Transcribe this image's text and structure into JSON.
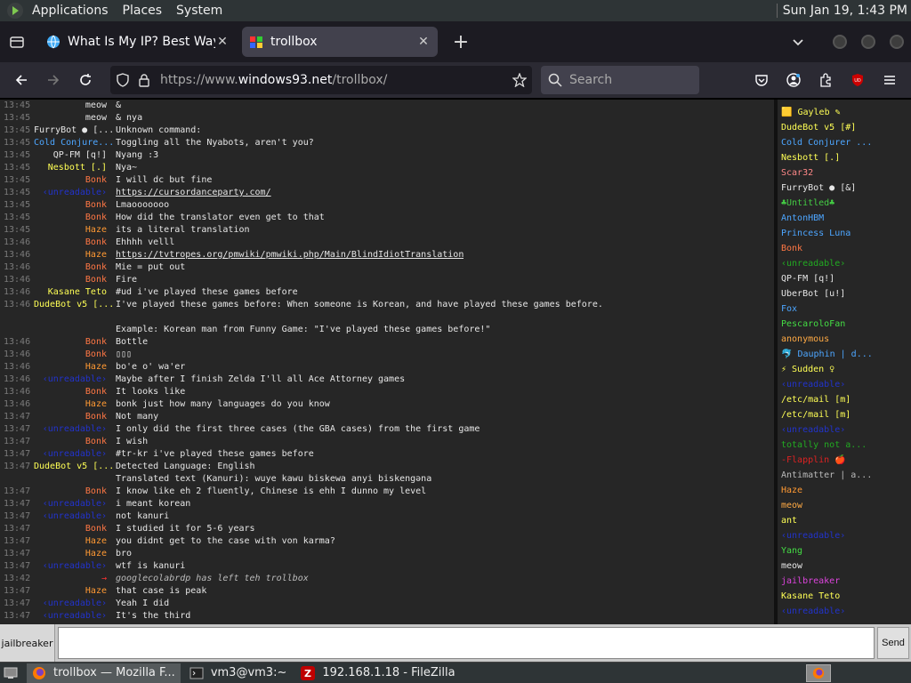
{
  "panel": {
    "menus": [
      "Applications",
      "Places",
      "System"
    ],
    "clock": "Sun Jan 19,  1:43 PM"
  },
  "tabs": [
    {
      "title": "What Is My IP? Best Way To",
      "active": false,
      "icon": "globe-icon"
    },
    {
      "title": "trollbox",
      "active": true,
      "icon": "windows93-icon"
    }
  ],
  "urlbar": {
    "prefix": "https://www.",
    "domain": "windows93.net",
    "path": "/trollbox/"
  },
  "search": {
    "placeholder": "Search"
  },
  "chat": [
    {
      "time": "13:45",
      "nick": "meow",
      "color": "#e6e6e6",
      "text": "&"
    },
    {
      "time": "13:45",
      "nick": "meow",
      "color": "#e6e6e6",
      "text": "& nya"
    },
    {
      "time": "13:45",
      "nick": "FurryBot ● [...",
      "color": "#e6e6e6",
      "text": "Unknown command:"
    },
    {
      "time": "13:45",
      "nick": "Cold Conjure...",
      "color": "#4da6ff",
      "text": "Toggling all the Nyabots, aren't you?"
    },
    {
      "time": "13:45",
      "nick": "QP-FM [q!]",
      "color": "#e6e6e6",
      "text": "Nyang :3"
    },
    {
      "time": "13:45",
      "nick": "Nesbott [.]",
      "color": "#ffff55",
      "text": "Nya~"
    },
    {
      "time": "13:45",
      "nick": "Bonk",
      "color": "#ff7744",
      "text": "I will dc but fine"
    },
    {
      "time": "13:45",
      "nick": "‹unreadable›",
      "color": "#2233cc",
      "text": "https://cursordanceparty.com/",
      "link": true
    },
    {
      "time": "13:45",
      "nick": "Bonk",
      "color": "#ff7744",
      "text": "Lmaooooooo"
    },
    {
      "time": "13:45",
      "nick": "Bonk",
      "color": "#ff7744",
      "text": "How did the translator even get to that"
    },
    {
      "time": "13:45",
      "nick": "Haze",
      "color": "#ff9933",
      "text": "its a literal translation"
    },
    {
      "time": "13:46",
      "nick": "Bonk",
      "color": "#ff7744",
      "text": "Ehhhh velll"
    },
    {
      "time": "13:46",
      "nick": "Haze",
      "color": "#ff9933",
      "text": "https://tvtropes.org/pmwiki/pmwiki.php/Main/BlindIdiotTranslation",
      "link": true
    },
    {
      "time": "13:46",
      "nick": "Bonk",
      "color": "#ff7744",
      "text": "Mie = put out"
    },
    {
      "time": "13:46",
      "nick": "Bonk",
      "color": "#ff7744",
      "text": "Fire"
    },
    {
      "time": "13:46",
      "nick": "Kasane Teto",
      "color": "#ffff55",
      "text": "#ud i've played these games before"
    },
    {
      "time": "13:46",
      "nick": "DudeBot v5 [...",
      "color": "#ffff55",
      "text": "I've played these games before: When someone is Korean, and have played these games before."
    },
    {
      "time": "",
      "nick": "",
      "color": "#e6e6e6",
      "text": ""
    },
    {
      "time": "",
      "nick": "",
      "color": "#e6e6e6",
      "text": "Example: Korean man from Funny Game: \"I've played these games before!\""
    },
    {
      "time": "13:46",
      "nick": "Bonk",
      "color": "#ff7744",
      "text": "Bottle"
    },
    {
      "time": "13:46",
      "nick": "Bonk",
      "color": "#ff7744",
      "text": "▯▯▯"
    },
    {
      "time": "13:46",
      "nick": "Haze",
      "color": "#ff9933",
      "text": "bo'e o' wa'er"
    },
    {
      "time": "13:46",
      "nick": "‹unreadable›",
      "color": "#2233cc",
      "text": "Maybe after I finish Zelda I'll all Ace Attorney games"
    },
    {
      "time": "13:46",
      "nick": "Bonk",
      "color": "#ff7744",
      "text": "It looks like"
    },
    {
      "time": "13:46",
      "nick": "Haze",
      "color": "#ff9933",
      "text": "bonk just how many languages do you know"
    },
    {
      "time": "13:47",
      "nick": "Bonk",
      "color": "#ff7744",
      "text": "Not many"
    },
    {
      "time": "13:47",
      "nick": "‹unreadable›",
      "color": "#2233cc",
      "text": "I only did the first three cases (the GBA cases) from the first game"
    },
    {
      "time": "13:47",
      "nick": "Bonk",
      "color": "#ff7744",
      "text": "I wish"
    },
    {
      "time": "13:47",
      "nick": "‹unreadable›",
      "color": "#2233cc",
      "text": "#tr-kr i've played these games before"
    },
    {
      "time": "13:47",
      "nick": "DudeBot v5 [...",
      "color": "#ffff55",
      "text": "Detected Language: English"
    },
    {
      "time": "",
      "nick": "",
      "color": "#e6e6e6",
      "text": "Translated text (Kanuri): wuye kawu biskewa anyi biskengәna"
    },
    {
      "time": "13:47",
      "nick": "Bonk",
      "color": "#ff7744",
      "text": "I know like eh 2 fluently, Chinese is ehh I dunno my level"
    },
    {
      "time": "13:47",
      "nick": "‹unreadable›",
      "color": "#2233cc",
      "text": "i meant korean"
    },
    {
      "time": "13:47",
      "nick": "‹unreadable›",
      "color": "#2233cc",
      "text": "not kanuri"
    },
    {
      "time": "13:47",
      "nick": "Bonk",
      "color": "#ff7744",
      "text": "I studied it for 5-6 years"
    },
    {
      "time": "13:47",
      "nick": "Haze",
      "color": "#ff9933",
      "text": "you didnt get to the case with von karma?"
    },
    {
      "time": "13:47",
      "nick": "Haze",
      "color": "#ff9933",
      "text": "bro"
    },
    {
      "time": "13:47",
      "nick": "‹unreadable›",
      "color": "#2233cc",
      "text": "wtf is kanuri"
    },
    {
      "time": "13:42",
      "nick": "→",
      "color": "#ff3333",
      "text": "googlecolabrdp has left teh trollbox",
      "system": true
    },
    {
      "time": "13:47",
      "nick": "Haze",
      "color": "#ff9933",
      "text": "that case is peak"
    },
    {
      "time": "13:47",
      "nick": "‹unreadable›",
      "color": "#2233cc",
      "text": "Yeah I did"
    },
    {
      "time": "13:47",
      "nick": "‹unreadable›",
      "color": "#2233cc",
      "text": "It's the third"
    }
  ],
  "users": [
    {
      "name": "🟨 Gayleb ✎",
      "color": "#ffff55"
    },
    {
      "name": "DudeBot v5 [#]",
      "color": "#ffff55"
    },
    {
      "name": "Cold Conjurer ...",
      "color": "#4da6ff"
    },
    {
      "name": "Nesbott [.]",
      "color": "#ffff55"
    },
    {
      "name": "Scar32",
      "color": "#ff8888"
    },
    {
      "name": "FurryBot ● [&]",
      "color": "#e6e6e6"
    },
    {
      "name": "♣Untitled♣",
      "color": "#44cc44"
    },
    {
      "name": "AntonHBM",
      "color": "#4da6ff"
    },
    {
      "name": "Princess Luna",
      "color": "#4da6ff"
    },
    {
      "name": "Bonk",
      "color": "#ff7744"
    },
    {
      "name": "‹unreadable›",
      "color": "#22aa22"
    },
    {
      "name": "QP-FM [q!]",
      "color": "#e6e6e6"
    },
    {
      "name": "UberBot [u!]",
      "color": "#e6e6e6"
    },
    {
      "name": "Fox",
      "color": "#4da6ff"
    },
    {
      "name": "PescaroloFan",
      "color": "#44dd44"
    },
    {
      "name": "anonymous",
      "color": "#ffaa44"
    },
    {
      "name": "🐬 Dauphin | d...",
      "color": "#4da6ff"
    },
    {
      "name": "⚡ Sudden ♀",
      "color": "#ffff55"
    },
    {
      "name": "‹unreadable›",
      "color": "#2233cc"
    },
    {
      "name": "/etc/mail [m]",
      "color": "#ffff55"
    },
    {
      "name": "/etc/mail [m]",
      "color": "#ffff55"
    },
    {
      "name": "‹unreadable›",
      "color": "#2233cc"
    },
    {
      "name": "totally not a...",
      "color": "#22aa22"
    },
    {
      "name": "-Flapplin 🍎",
      "color": "#dd2222"
    },
    {
      "name": "Antimatter | a...",
      "color": "#bbbbbb"
    },
    {
      "name": "Haze",
      "color": "#ff9933"
    },
    {
      "name": "meow",
      "color": "#ffaa44"
    },
    {
      "name": "ant",
      "color": "#ffff55"
    },
    {
      "name": "‹unreadable›",
      "color": "#2233cc"
    },
    {
      "name": "Yang",
      "color": "#44dd44"
    },
    {
      "name": "meow",
      "color": "#e6e6e6"
    },
    {
      "name": "jailbreaker",
      "color": "#dd44dd"
    },
    {
      "name": "Kasane Teto",
      "color": "#ffff55"
    },
    {
      "name": "‹unreadable›",
      "color": "#2233cc"
    }
  ],
  "input": {
    "nick": "jailbreaker",
    "send_label": "Send"
  },
  "taskbar": [
    {
      "label": "trollbox — Mozilla F...",
      "active": true,
      "icon": "firefox-icon"
    },
    {
      "label": "vm3@vm3:~",
      "active": false,
      "icon": "terminal-icon"
    },
    {
      "label": "192.168.1.18 - FileZilla",
      "active": false,
      "icon": "filezilla-icon"
    }
  ]
}
